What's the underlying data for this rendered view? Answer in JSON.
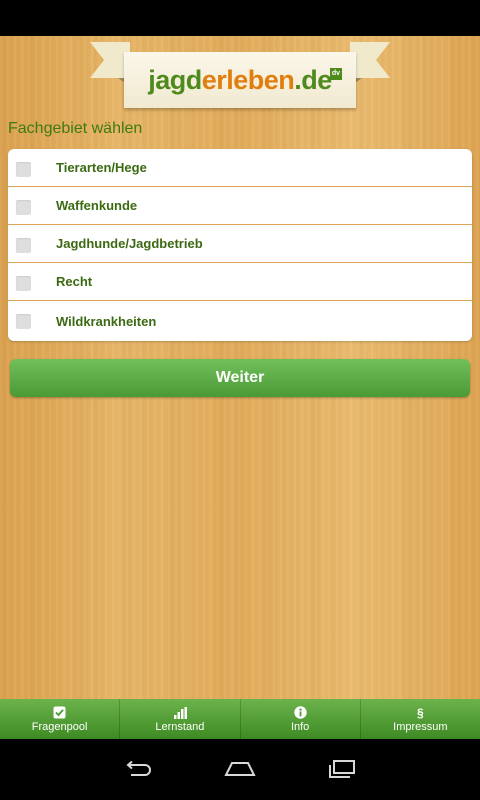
{
  "logo": {
    "part1": "jagd",
    "part2": "erleben",
    "part3": ".de",
    "badge": "dv"
  },
  "section_title": "Fachgebiet wählen",
  "topics": [
    {
      "label": "Tierarten/Hege",
      "checked": false
    },
    {
      "label": "Waffenkunde",
      "checked": false
    },
    {
      "label": "Jagdhunde/Jagdbetrieb",
      "checked": false
    },
    {
      "label": "Recht",
      "checked": false
    },
    {
      "label": "Wildkrankheiten",
      "checked": false
    }
  ],
  "weiter_label": "Weiter",
  "tabs": [
    {
      "label": "Fragenpool",
      "icon": "checkbox-icon"
    },
    {
      "label": "Lernstand",
      "icon": "bar-chart-icon"
    },
    {
      "label": "Info",
      "icon": "info-icon"
    },
    {
      "label": "Impressum",
      "icon": "paragraph-icon",
      "glyph": "§"
    }
  ],
  "colors": {
    "accent_green": "#4f8a1e",
    "accent_orange": "#e07e10",
    "button_green": "#5aac41"
  }
}
